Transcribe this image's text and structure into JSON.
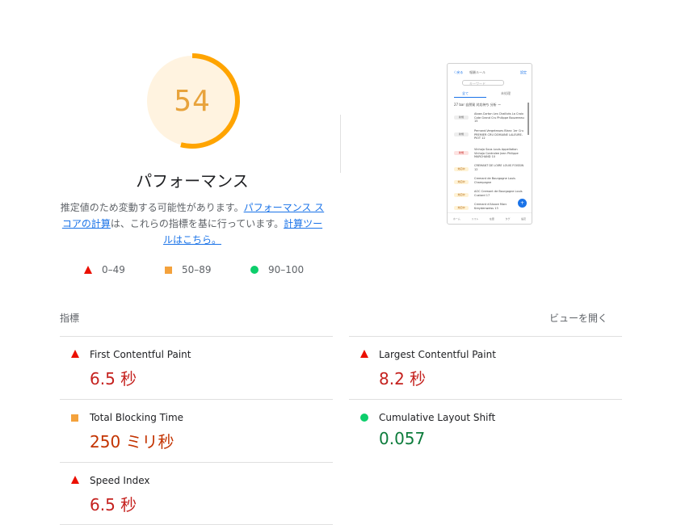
{
  "gauge": {
    "score": "54",
    "fraction": 0.54,
    "color": "#ffa400",
    "bg": "#fff3e0"
  },
  "title": "パフォーマンス",
  "description": {
    "text1": "推定値のため変動する可能性があります。",
    "link1": "パフォーマンス スコアの計算",
    "text2": "は、これらの指標を基に行っています。",
    "link2": "計算ツールはこちら。"
  },
  "legend": [
    {
      "label": "0–49",
      "icon": "red-triangle"
    },
    {
      "label": "50–89",
      "icon": "orange-square"
    },
    {
      "label": "90–100",
      "icon": "green-circle"
    }
  ],
  "screenshot": {
    "top_left": "〈 戻る",
    "top_center": "報酬ルール",
    "top_right": "設定",
    "search_placeholder": "キーワード",
    "tab1": "全て",
    "tab2": "未処理",
    "header": "27 bar  自然発  対応待ち  分析  ー",
    "rows": [
      {
        "badge": "新規",
        "text": "Aloxe-Corton Les Chaillots La Croix Cote Grand Cru Philippe Bouzereau 15"
      },
      {
        "badge": "新規",
        "text": "Pernand-Vergelesses Blanc 1er Cru PREMIER CRU DOMAINE LALEURE-PIOT 12"
      },
      {
        "badge": "新規",
        "text": "Vinhojo Sous Louis Appellation Vinhojo Controlee Jean Philippe MARCHAND 10"
      },
      {
        "badge": "対応中",
        "text": "CREMANT DE LOIRE LOUIS FOISSIN 12"
      },
      {
        "badge": "対応中",
        "text": "Cremant de Bourgogne Louis Champagne"
      },
      {
        "badge": "対応中",
        "text": "AOC Cremant de Bourgogne Louis Custard 17"
      },
      {
        "badge": "対応中",
        "text": "Cremant d'Alsace Marc Kreydenweiss 13"
      }
    ],
    "nav": [
      "ホーム",
      "リスト",
      "在庫",
      "タグ",
      "設定"
    ],
    "fab": "+"
  },
  "metrics": {
    "heading": "指標",
    "open_view": "ビューを開く",
    "items": [
      {
        "label": "First Contentful Paint",
        "value": "6.5 秒",
        "status": "red"
      },
      {
        "label": "Largest Contentful Paint",
        "value": "8.2 秒",
        "status": "red"
      },
      {
        "label": "Total Blocking Time",
        "value": "250 ミリ秒",
        "status": "orange"
      },
      {
        "label": "Cumulative Layout Shift",
        "value": "0.057",
        "status": "green"
      },
      {
        "label": "Speed Index",
        "value": "6.5 秒",
        "status": "red"
      }
    ]
  },
  "colors": {
    "red": "#eb0f00",
    "orange": "#ffa400",
    "green": "#0cce6b",
    "link": "#1a73e8"
  }
}
